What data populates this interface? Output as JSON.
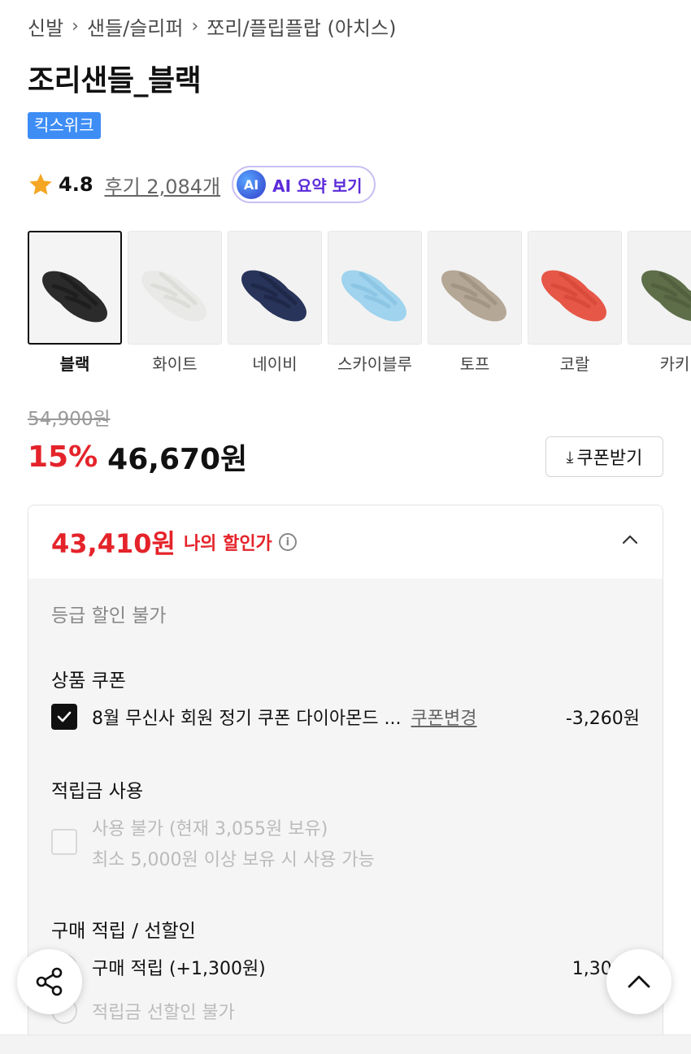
{
  "breadcrumb": [
    "신발",
    "샌들/슬리퍼",
    "쪼리/플립플랍 (아치스)"
  ],
  "product": {
    "title": "조리샌들_블랙",
    "brand_tag": "킥스위크",
    "rating": "4.8",
    "review_link": "후기 2,084개",
    "ai_badge": "AI",
    "ai_summary_label": "AI 요약 보기"
  },
  "swatches": [
    {
      "label": "블랙",
      "color": "#2b2b2b",
      "strap": "#1e1e1e",
      "selected": true
    },
    {
      "label": "화이트",
      "color": "#e9e9e7",
      "strap": "#dcdcd9",
      "selected": false
    },
    {
      "label": "네이비",
      "color": "#28345a",
      "strap": "#1f2848",
      "selected": false
    },
    {
      "label": "스카이블루",
      "color": "#9fd3ee",
      "strap": "#8cc6e4",
      "selected": false
    },
    {
      "label": "토프",
      "color": "#b5a795",
      "strap": "#a39583",
      "selected": false
    },
    {
      "label": "코랄",
      "color": "#e65747",
      "strap": "#d84a3a",
      "selected": false
    },
    {
      "label": "카키",
      "color": "#5e6e49",
      "strap": "#52603f",
      "selected": false
    }
  ],
  "price": {
    "original": "54,900원",
    "discount": "15%",
    "sale": "46,670원",
    "coupon_button": "쿠폰받기"
  },
  "my_discount": {
    "price": "43,410원",
    "label": "나의 할인가",
    "info_icon": "i",
    "grade": "등급 할인 불가",
    "product_coupon_title": "상품 쿠폰",
    "coupon_name": "8월 무신사 회원 정기 쿠폰 다이아몬드 ...",
    "coupon_change": "쿠폰변경",
    "coupon_amount": "-3,260원",
    "points_title": "적립금 사용",
    "points_line1": "사용 불가 (현재 3,055원 보유)",
    "points_line2": "최소 5,000원 이상 보유 시 사용 가능",
    "purchase_title": "구매 적립 / 선할인",
    "purchase_earn": "구매 적립 (+1,300원)",
    "purchase_earn_amount": "1,300원",
    "pre_discount": "적립금 선할인 불가"
  },
  "colors": {
    "accent_red": "#e4232a",
    "brand_blue": "#3d8df5",
    "ai_purple": "#5b2bd9",
    "star": "#f5a623"
  },
  "icons": [
    "star-icon",
    "ai-icon",
    "download-icon",
    "info-icon",
    "chevron-up-icon",
    "check-icon",
    "share-icon",
    "scroll-top-icon"
  ]
}
